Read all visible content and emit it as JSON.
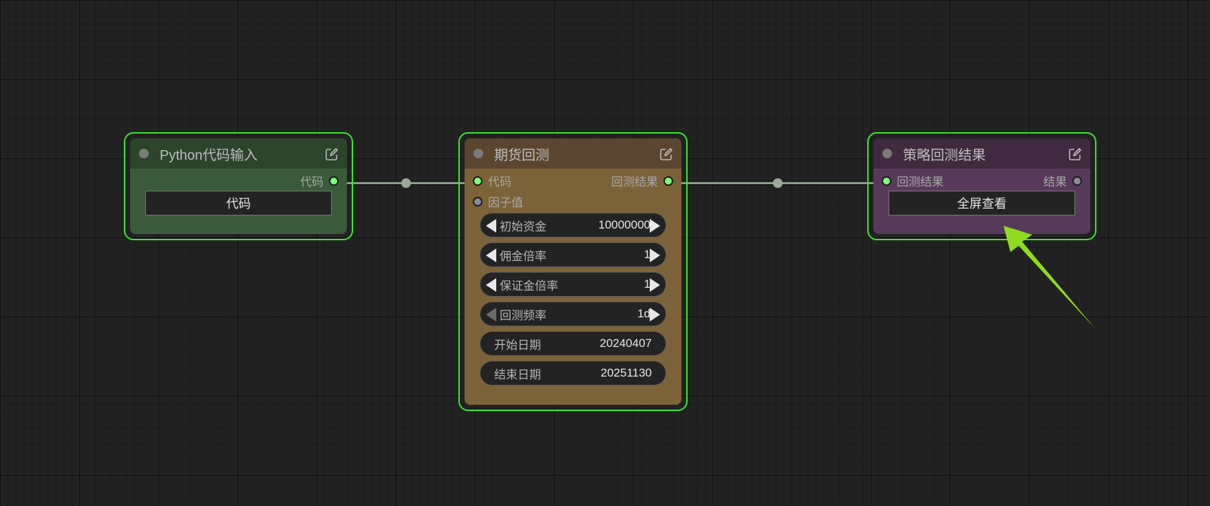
{
  "colors": {
    "selection_border": "#3bea2b",
    "node_python": "#3a5a3b",
    "node_python_title": "#2c432c",
    "node_backtest": "#7c6238",
    "node_backtest_title": "#5a4630",
    "node_result": "#573a59",
    "node_result_title": "#3f2a40",
    "annotation_arrow": "#8fdc1e"
  },
  "nodes": {
    "python": {
      "title": "Python代码输入",
      "output_label": "代码",
      "button_label": "代码"
    },
    "backtest": {
      "title": "期货回测",
      "inputs": [
        "代码",
        "因子值"
      ],
      "output_label": "回测结果",
      "widgets": [
        {
          "label": "初始资金",
          "value": "10000000"
        },
        {
          "label": "佣金倍率",
          "value": "1"
        },
        {
          "label": "保证金倍率",
          "value": "1"
        },
        {
          "label": "回测频率",
          "value": "1d"
        }
      ],
      "start_date": {
        "label": "开始日期",
        "value": "20240407"
      },
      "end_date": {
        "label": "结束日期",
        "value": "20251130"
      }
    },
    "result": {
      "title": "策略回测结果",
      "input_label": "回测结果",
      "output_label": "结果",
      "button_label": "全屏查看"
    }
  },
  "icons": [
    "edit-icon",
    "left-arrow-icon",
    "right-arrow-icon",
    "annotation-arrow-icon"
  ]
}
